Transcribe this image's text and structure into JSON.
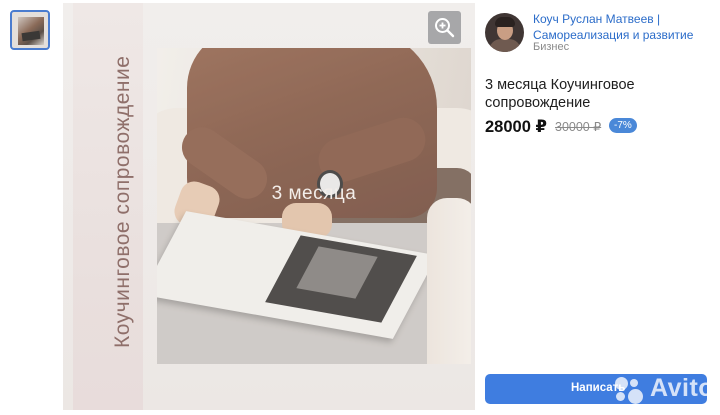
{
  "gallery": {
    "photo_caption": "3 месяца",
    "vertical_title": "Коучинговое сопровождение"
  },
  "seller": {
    "name": "Коуч Руслан Матвеев | Самореализация и развитие",
    "category": "Бизнес"
  },
  "listing": {
    "title": "3 месяца Коучинговое сопровождение",
    "price": "28000 ₽",
    "old_price": "30000 ₽",
    "discount": "-7%"
  },
  "actions": {
    "write_label": "Написать"
  },
  "watermark": {
    "text": "Avito"
  },
  "colors": {
    "accent": "#3f7de0",
    "link": "#2b6cc9",
    "discount_badge": "#4a88d8"
  },
  "icons": [
    "zoom-in-icon",
    "avito-logo-dots"
  ]
}
